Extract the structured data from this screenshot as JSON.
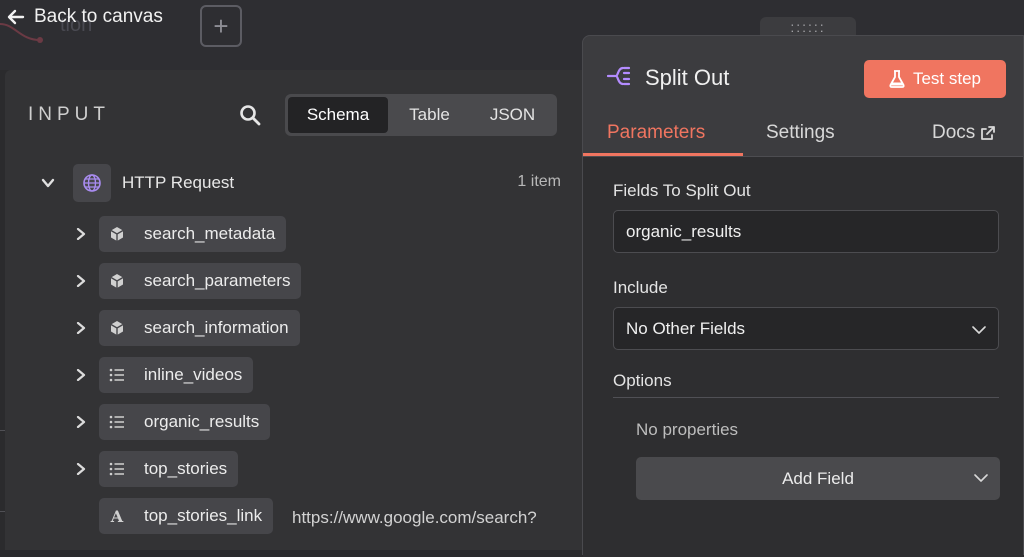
{
  "topbar": {
    "back_label": "Back to canvas",
    "canvas_ghost_text": "tion",
    "add_label": "+"
  },
  "input_panel": {
    "title": "INPUT",
    "view_options": [
      "Schema",
      "Table",
      "JSON"
    ],
    "active_view": "Schema",
    "root": {
      "label": "HTTP Request",
      "count": "1 item",
      "icon": "globe-icon"
    },
    "fields": [
      {
        "label": "search_metadata",
        "type_icon": "cube-icon"
      },
      {
        "label": "search_parameters",
        "type_icon": "cube-icon"
      },
      {
        "label": "search_information",
        "type_icon": "cube-icon"
      },
      {
        "label": "inline_videos",
        "type_icon": "list-icon"
      },
      {
        "label": "organic_results",
        "type_icon": "list-icon"
      },
      {
        "label": "top_stories",
        "type_icon": "list-icon"
      },
      {
        "label": "top_stories_link",
        "type_icon": "text-type-icon",
        "value": "https://www.google.com/search?"
      }
    ]
  },
  "params_panel": {
    "node_title": "Split Out",
    "test_button": "Test step",
    "tabs": [
      "Parameters",
      "Settings",
      "Docs"
    ],
    "active_tab": "Parameters",
    "fields_to_split_label": "Fields To Split Out",
    "fields_to_split_value": "organic_results",
    "include_label": "Include",
    "include_value": "No Other Fields",
    "options_label": "Options",
    "no_properties": "No properties",
    "add_field_label": "Add Field"
  },
  "colors": {
    "accent": "#f07560",
    "node_icon": "#b48cff",
    "panel_bg": "#3c3c3f",
    "input_bg": "#333335"
  }
}
